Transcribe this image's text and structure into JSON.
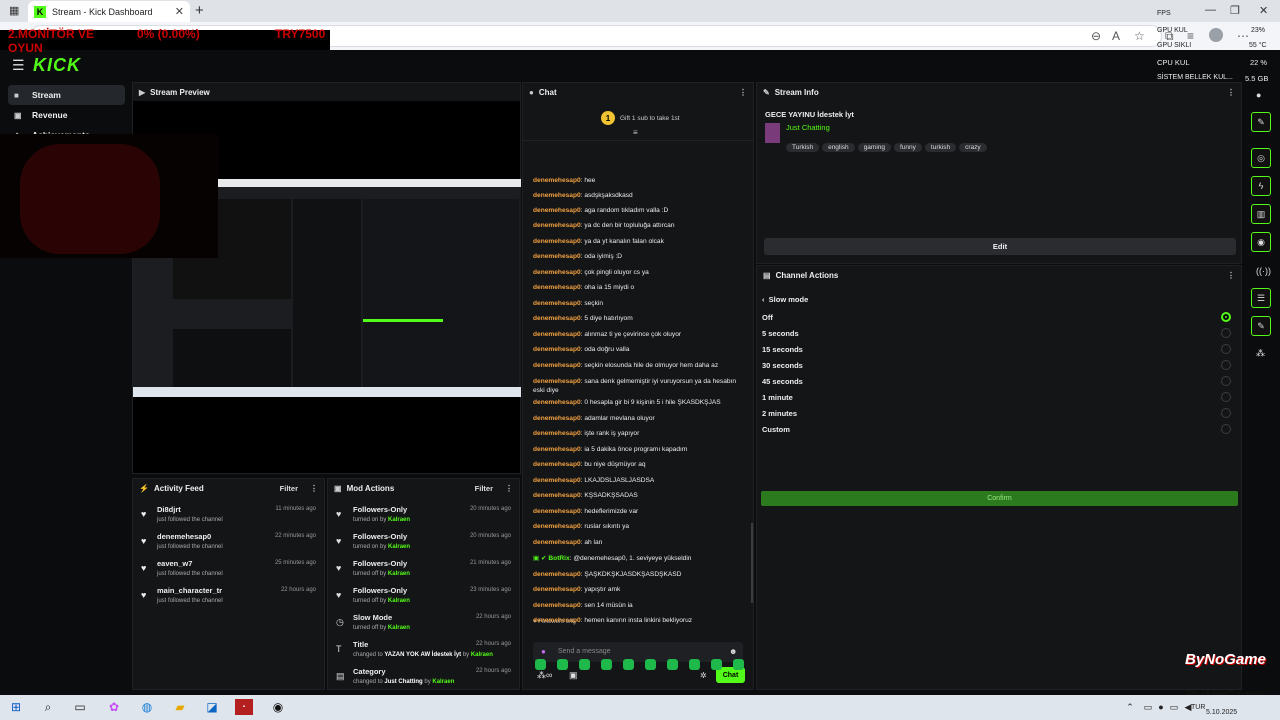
{
  "browser": {
    "tab_title": "Stream - Kick Dashboard",
    "favicon_letter": "K",
    "close_glyph": "✕",
    "new_tab_glyph": "+",
    "window_controls": [
      "—",
      "❐",
      "✕"
    ]
  },
  "overlay": {
    "line1": "2.MONİTÖR VE",
    "line2": "OYUN",
    "percent": "0% (0.00%)",
    "currency": "TRY7500",
    "fps": "FPS",
    "gpu_kul": "GPU KUL",
    "gpu_sikli": "GPU SIKLI",
    "gpu_val": "23%",
    "gpu_temp": "55 °C",
    "cpu_kul": "CPU KUL",
    "cpu_val": "22 %",
    "ram_label": "SİSTEM BELLEK KUL...",
    "ram_val": "5.5 GB",
    "brand": "ByNoGame",
    "brand2": "ByNoGame"
  },
  "nav": {
    "logo": "KICK",
    "sidebar": [
      {
        "label": "Stream",
        "icon": "■",
        "active": true
      },
      {
        "label": "Revenue",
        "icon": "▣",
        "active": false
      },
      {
        "label": "Achievements",
        "icon": "◆",
        "active": false
      }
    ]
  },
  "stream_preview": {
    "title": "Stream Preview"
  },
  "activity_feed": {
    "title": "Activity Feed",
    "filter": "Filter",
    "items": [
      {
        "name": "Di8djrt",
        "action": "just followed the channel",
        "time": "11 minutes ago"
      },
      {
        "name": "denemehesap0",
        "action": "just followed the channel",
        "time": "22 minutes ago"
      },
      {
        "name": "eaven_w7",
        "action": "just followed the channel",
        "time": "25 minutes ago"
      },
      {
        "name": "main_character_tr",
        "action": "just followed the channel",
        "time": "22 hours ago"
      }
    ]
  },
  "mod_actions": {
    "title": "Mod Actions",
    "filter": "Filter",
    "items": [
      {
        "name": "Followers-Only",
        "pre": "turned on by ",
        "bold": "",
        "mid": "",
        "user": "Kalraen",
        "time": "20 minutes ago",
        "icon": "♥"
      },
      {
        "name": "Followers-Only",
        "pre": "turned on by ",
        "bold": "",
        "mid": "",
        "user": "Kalraen",
        "time": "20 minutes ago",
        "icon": "♥"
      },
      {
        "name": "Followers-Only",
        "pre": "turned off by ",
        "bold": "",
        "mid": "",
        "user": "Kalraen",
        "time": "21 minutes ago",
        "icon": "♥"
      },
      {
        "name": "Followers-Only",
        "pre": "turned off by ",
        "bold": "",
        "mid": "",
        "user": "Kalraen",
        "time": "23 minutes ago",
        "icon": "♥"
      },
      {
        "name": "Slow Mode",
        "pre": "turned off by ",
        "bold": "",
        "mid": "",
        "user": "Kalraen",
        "time": "22 hours ago",
        "icon": "◷"
      },
      {
        "name": "Title",
        "pre": "changed to ",
        "bold": "YAZAN YOK AW İdestek İyt",
        "mid": " by ",
        "user": "Kalraen",
        "time": "22 hours ago",
        "icon": "T"
      },
      {
        "name": "Category",
        "pre": "changed to ",
        "bold": "Just Chatting",
        "mid": " by ",
        "user": "Kalraen",
        "time": "22 hours ago",
        "icon": "▤"
      }
    ]
  },
  "chat": {
    "title": "Chat",
    "gift_text": "Gift 1 sub to take 1st",
    "gift_count": "1",
    "messages": [
      {
        "user": "denemehesap0",
        "text": "hee"
      },
      {
        "user": "denemehesap0",
        "text": "asdşkşaksdkasd"
      },
      {
        "user": "denemehesap0",
        "text": "aga random tıkladım valla :D"
      },
      {
        "user": "denemehesap0",
        "text": "ya dc den bir topluluğa attırcan"
      },
      {
        "user": "denemehesap0",
        "text": "ya da yt kanalın falan olcak"
      },
      {
        "user": "denemehesap0",
        "text": "oda iyimiş :D"
      },
      {
        "user": "denemehesap0",
        "text": "çok pingli oluyor cs ya"
      },
      {
        "user": "denemehesap0",
        "text": "oha ia 15 miydi o"
      },
      {
        "user": "denemehesap0",
        "text": "seçkin"
      },
      {
        "user": "denemehesap0",
        "text": "5 diye hatırlıyom"
      },
      {
        "user": "denemehesap0",
        "text": "alınmaz ti ye çevirince çok oluyor"
      },
      {
        "user": "denemehesap0",
        "text": "oda doğru valla"
      },
      {
        "user": "denemehesap0",
        "text": "seçkin elosunda hile de olmuyor hem daha az"
      },
      {
        "user": "denemehesap0",
        "text": "sana denk gelmemiştir iyi vuruyorsun ya da hesabın eski diye"
      },
      {
        "user": "denemehesap0",
        "text": "0 hesapla gir bi 9 kişinin 5 i hile ŞKASDKŞJAS"
      },
      {
        "user": "denemehesap0",
        "text": "adamlar mevlana oluyor"
      },
      {
        "user": "denemehesap0",
        "text": "işte rank iş yapıyor"
      },
      {
        "user": "denemehesap0",
        "text": "ia 5 dakika önce programı kapadım"
      },
      {
        "user": "denemehesap0",
        "text": "bu niye düşmüyor aq"
      },
      {
        "user": "denemehesap0",
        "text": "LKAJDSLJASLJASDSA"
      },
      {
        "user": "denemehesap0",
        "text": "KŞSADKŞSADAS"
      },
      {
        "user": "denemehesap0",
        "text": "hedeflerimizde var"
      },
      {
        "user": "denemehesap0",
        "text": "ruslar sıkıntı ya"
      },
      {
        "user": "denemehesap0",
        "text": "ah lan"
      },
      {
        "user": "BotRix",
        "text": "@denemehesap0, 1. seviyeye yükseldin",
        "bot": true
      },
      {
        "user": "denemehesap0",
        "text": "ŞAŞKDKŞKJASDKŞASDŞKASD"
      },
      {
        "user": "denemehesap0",
        "text": "yapıştır amk"
      },
      {
        "user": "denemehesap0",
        "text": "sen 14 müsün ia"
      },
      {
        "user": "denemehesap0",
        "text": "hemen kanırın insta linkini bekliyoruz"
      }
    ],
    "followers_only": "Followers only",
    "placeholder": "Send a message",
    "send_label": "Chat"
  },
  "stream_info": {
    "title": "Stream Info",
    "stream_title": "GECE YAYINU İdestek İyt",
    "category": "Just Chatting",
    "tags": [
      "Turkish",
      "english",
      "gaming",
      "funny",
      "turkish",
      "crazy"
    ],
    "edit_label": "Edit"
  },
  "channel_actions": {
    "title": "Channel Actions",
    "back_label": "Slow mode",
    "options": [
      "Off",
      "5 seconds",
      "15 seconds",
      "30 seconds",
      "45 seconds",
      "1 minute",
      "2 minutes",
      "Custom"
    ],
    "selected": "Off",
    "confirm_label": "Confirm"
  },
  "taskbar": {
    "lang": "TUR",
    "date": "5.10.2025"
  },
  "colors": {
    "accent": "#53fc18",
    "username": "#f0a040",
    "panel": "#141517",
    "bg": "#0b0c0e"
  }
}
